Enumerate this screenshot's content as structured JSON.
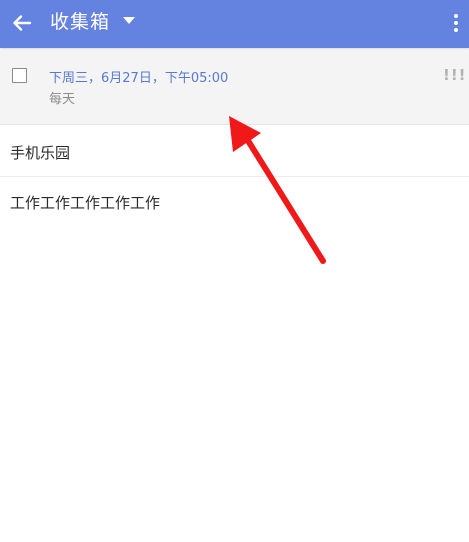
{
  "header": {
    "title": "收集箱",
    "back_icon": "arrow-left-icon",
    "dropdown_icon": "caret-down-icon",
    "more_icon": "more-vert-icon",
    "color": "#6482e0"
  },
  "task": {
    "due": "下周三，6月27日，下午05:00",
    "repeat": "每天",
    "priority": "!!!",
    "due_color": "#5778d6"
  },
  "items": [
    {
      "label": "手机乐园"
    },
    {
      "label": "工作工作工作工作工作"
    }
  ],
  "annotation": {
    "icon": "red-arrow-icon",
    "color": "#f01818"
  }
}
